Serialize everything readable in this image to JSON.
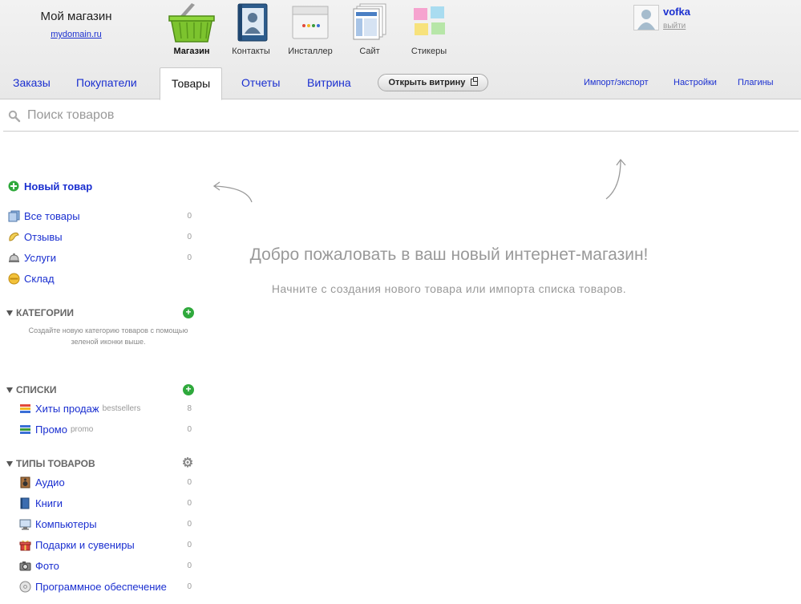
{
  "brand": {
    "name": "Мой магазин",
    "domain": "mydomain.ru"
  },
  "apps": [
    {
      "label": "Магазин",
      "icon": "basket-icon",
      "active": true
    },
    {
      "label": "Контакты",
      "icon": "contacts-book-icon",
      "active": false
    },
    {
      "label": "Инсталлер",
      "icon": "installer-icon",
      "active": false
    },
    {
      "label": "Сайт",
      "icon": "site-pages-icon",
      "active": false
    },
    {
      "label": "Стикеры",
      "icon": "stickers-icon",
      "active": false
    }
  ],
  "user": {
    "name": "vofka",
    "logout": "выйти"
  },
  "tabs": {
    "orders": "Заказы",
    "customers": "Покупатели",
    "products": "Товары",
    "reports": "Отчеты",
    "storefront": "Витрина",
    "open_storefront": "Открыть витрину",
    "import_export": "Импорт/экспорт",
    "settings": "Настройки",
    "plugins": "Плагины"
  },
  "search": {
    "placeholder": "Поиск товаров"
  },
  "sidebar": {
    "new_product": "Новый товар",
    "main": [
      {
        "label": "Все товары",
        "count": "0",
        "icon": "all-products-icon"
      },
      {
        "label": "Отзывы",
        "count": "0",
        "icon": "reviews-icon"
      },
      {
        "label": "Услуги",
        "count": "0",
        "icon": "services-bell-icon"
      },
      {
        "label": "Склад",
        "count": "",
        "icon": "stock-icon"
      }
    ],
    "categories": {
      "title": "КАТЕГОРИИ",
      "hint": "Создайте новую категорию товаров с помощью зеленой иконки выше."
    },
    "lists": {
      "title": "СПИСКИ",
      "items": [
        {
          "label": "Хиты продаж",
          "sub": "bestsellers",
          "count": "8"
        },
        {
          "label": "Промо",
          "sub": "promo",
          "count": "0"
        }
      ]
    },
    "types": {
      "title": "ТИПЫ ТОВАРОВ",
      "items": [
        {
          "label": "Аудио",
          "count": "0",
          "icon": "audio-speaker-icon"
        },
        {
          "label": "Книги",
          "count": "0",
          "icon": "books-icon"
        },
        {
          "label": "Компьютеры",
          "count": "0",
          "icon": "computer-icon"
        },
        {
          "label": "Подарки и сувениры",
          "count": "0",
          "icon": "gift-icon"
        },
        {
          "label": "Фото",
          "count": "0",
          "icon": "camera-icon"
        },
        {
          "label": "Программное обеспечение",
          "count": "0",
          "icon": "software-disc-icon"
        }
      ]
    }
  },
  "main": {
    "welcome_title": "Добро пожаловать в ваш новый интернет-магазин!",
    "welcome_subtitle": "Начните с создания нового товара или импорта списка товаров."
  }
}
